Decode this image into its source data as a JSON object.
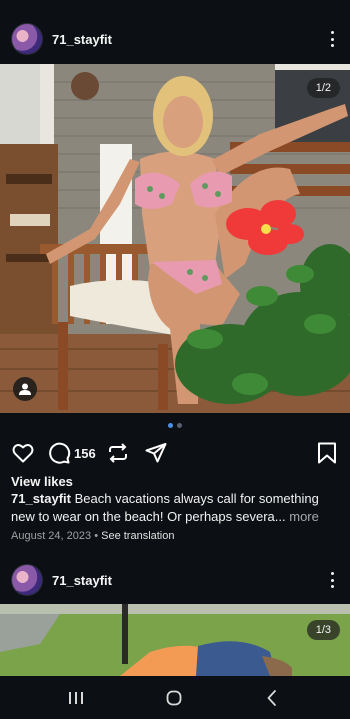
{
  "post1": {
    "username": "71_stayfit",
    "counter": "1/2",
    "comments_count": "156",
    "view_likes": "View likes",
    "caption_user": "71_stayfit",
    "caption_text": "Beach vacations always call for something new to wear on the beach! Or perhaps severa...",
    "caption_more": "more",
    "date": "August 24, 2023",
    "separator": "•",
    "see_translation": "See translation"
  },
  "post2": {
    "username": "71_stayfit",
    "counter": "1/3"
  },
  "icons": [
    "more-icon",
    "person-tag-icon",
    "heart-icon",
    "comment-icon",
    "repost-icon",
    "share-icon",
    "bookmark-icon",
    "recents-icon",
    "home-icon",
    "back-icon"
  ],
  "colors": {
    "background": "#0c0f14",
    "active_dot": "#4a90e6",
    "text": "#f5f5f5",
    "muted": "#a0a0a0"
  }
}
